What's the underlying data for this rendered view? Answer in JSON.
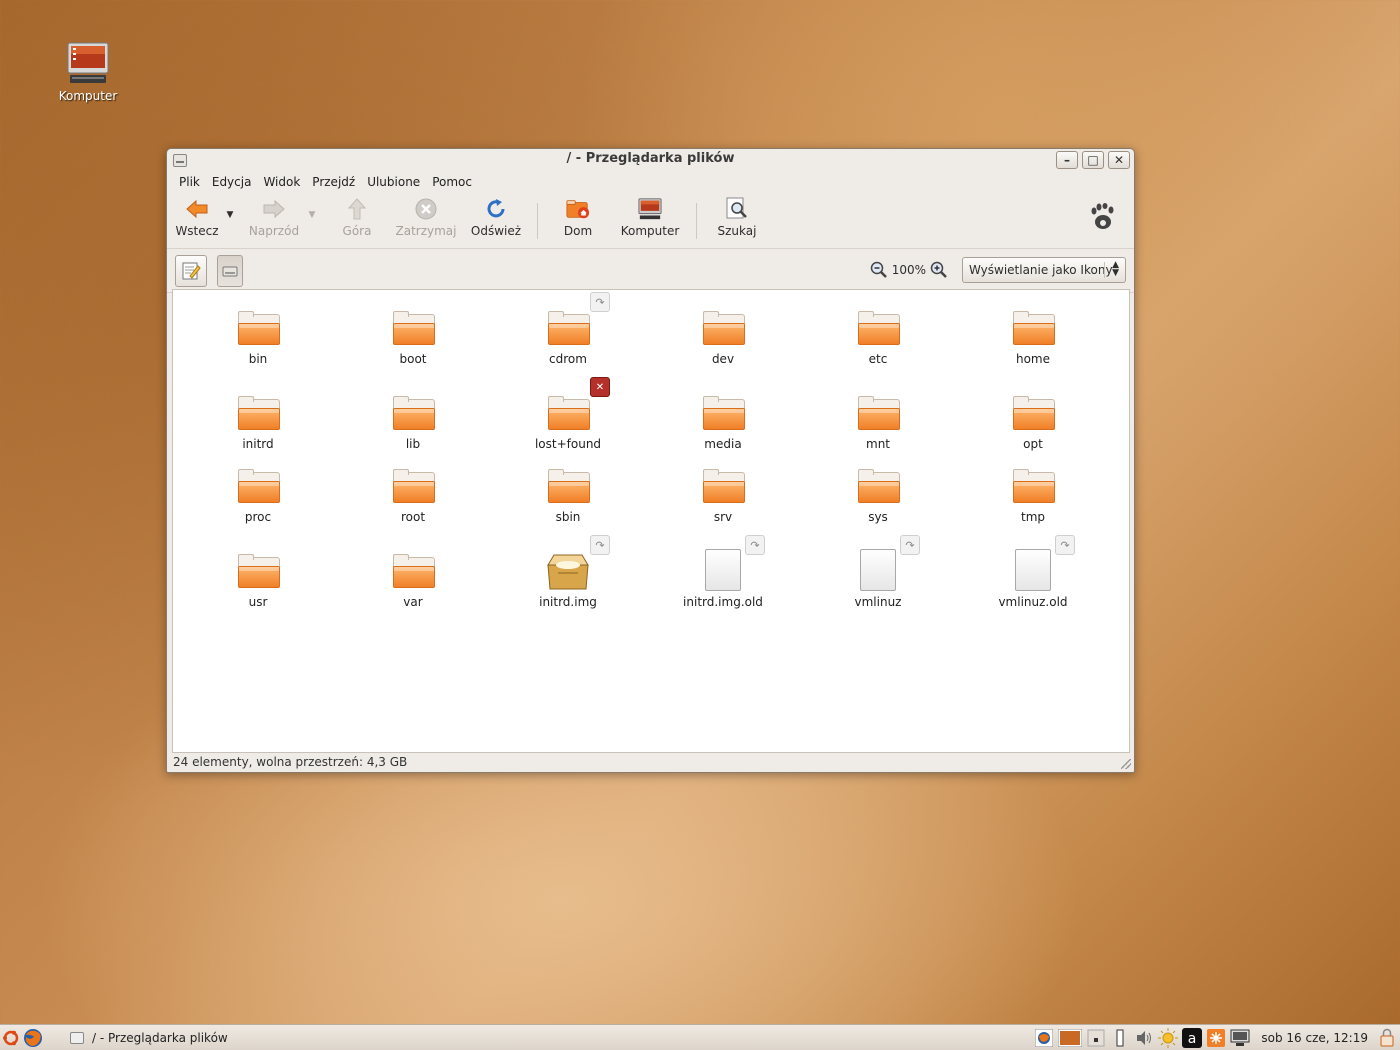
{
  "desktop": {
    "icons": [
      {
        "label": "Komputer"
      }
    ]
  },
  "window": {
    "title": "/ - Przeglądarka plików",
    "controls": {
      "minimize": "–",
      "maximize": "□",
      "close": "✕"
    }
  },
  "menubar": {
    "items": [
      "Plik",
      "Edycja",
      "Widok",
      "Przejdź",
      "Ulubione",
      "Pomoc"
    ]
  },
  "toolbar": {
    "back": "Wstecz",
    "forward": "Naprzód",
    "up": "Góra",
    "stop": "Zatrzymaj",
    "reload": "Odśwież",
    "home": "Dom",
    "computer": "Komputer",
    "search": "Szukaj"
  },
  "locationbar": {
    "zoom_level": "100%",
    "view_mode": "Wyświetlanie jako Ikony"
  },
  "files": [
    {
      "name": "bin",
      "type": "folder"
    },
    {
      "name": "boot",
      "type": "folder"
    },
    {
      "name": "cdrom",
      "type": "folder",
      "emblem": "symlink"
    },
    {
      "name": "dev",
      "type": "folder"
    },
    {
      "name": "etc",
      "type": "folder"
    },
    {
      "name": "home",
      "type": "folder"
    },
    {
      "name": "initrd",
      "type": "folder"
    },
    {
      "name": "lib",
      "type": "folder"
    },
    {
      "name": "lost+found",
      "type": "folder",
      "emblem": "unreadable"
    },
    {
      "name": "media",
      "type": "folder"
    },
    {
      "name": "mnt",
      "type": "folder"
    },
    {
      "name": "opt",
      "type": "folder"
    },
    {
      "name": "proc",
      "type": "folder"
    },
    {
      "name": "root",
      "type": "folder"
    },
    {
      "name": "sbin",
      "type": "folder"
    },
    {
      "name": "srv",
      "type": "folder"
    },
    {
      "name": "sys",
      "type": "folder"
    },
    {
      "name": "tmp",
      "type": "folder"
    },
    {
      "name": "usr",
      "type": "folder"
    },
    {
      "name": "var",
      "type": "folder"
    },
    {
      "name": "initrd.img",
      "type": "package",
      "emblem": "symlink"
    },
    {
      "name": "initrd.img.old",
      "type": "file",
      "emblem": "symlink"
    },
    {
      "name": "vmlinuz",
      "type": "file",
      "emblem": "symlink"
    },
    {
      "name": "vmlinuz.old",
      "type": "file",
      "emblem": "symlink"
    }
  ],
  "statusbar": {
    "text": "24 elementy, wolna przestrzeń: 4,3 GB"
  },
  "panel": {
    "task_title": "/ - Przeglądarka plików",
    "clock": "sob 16 cze, 12:19"
  },
  "colors": {
    "folder_orange": "#f07f27",
    "window_bg": "#efebe7",
    "desktop_brown": "#c88c52"
  }
}
